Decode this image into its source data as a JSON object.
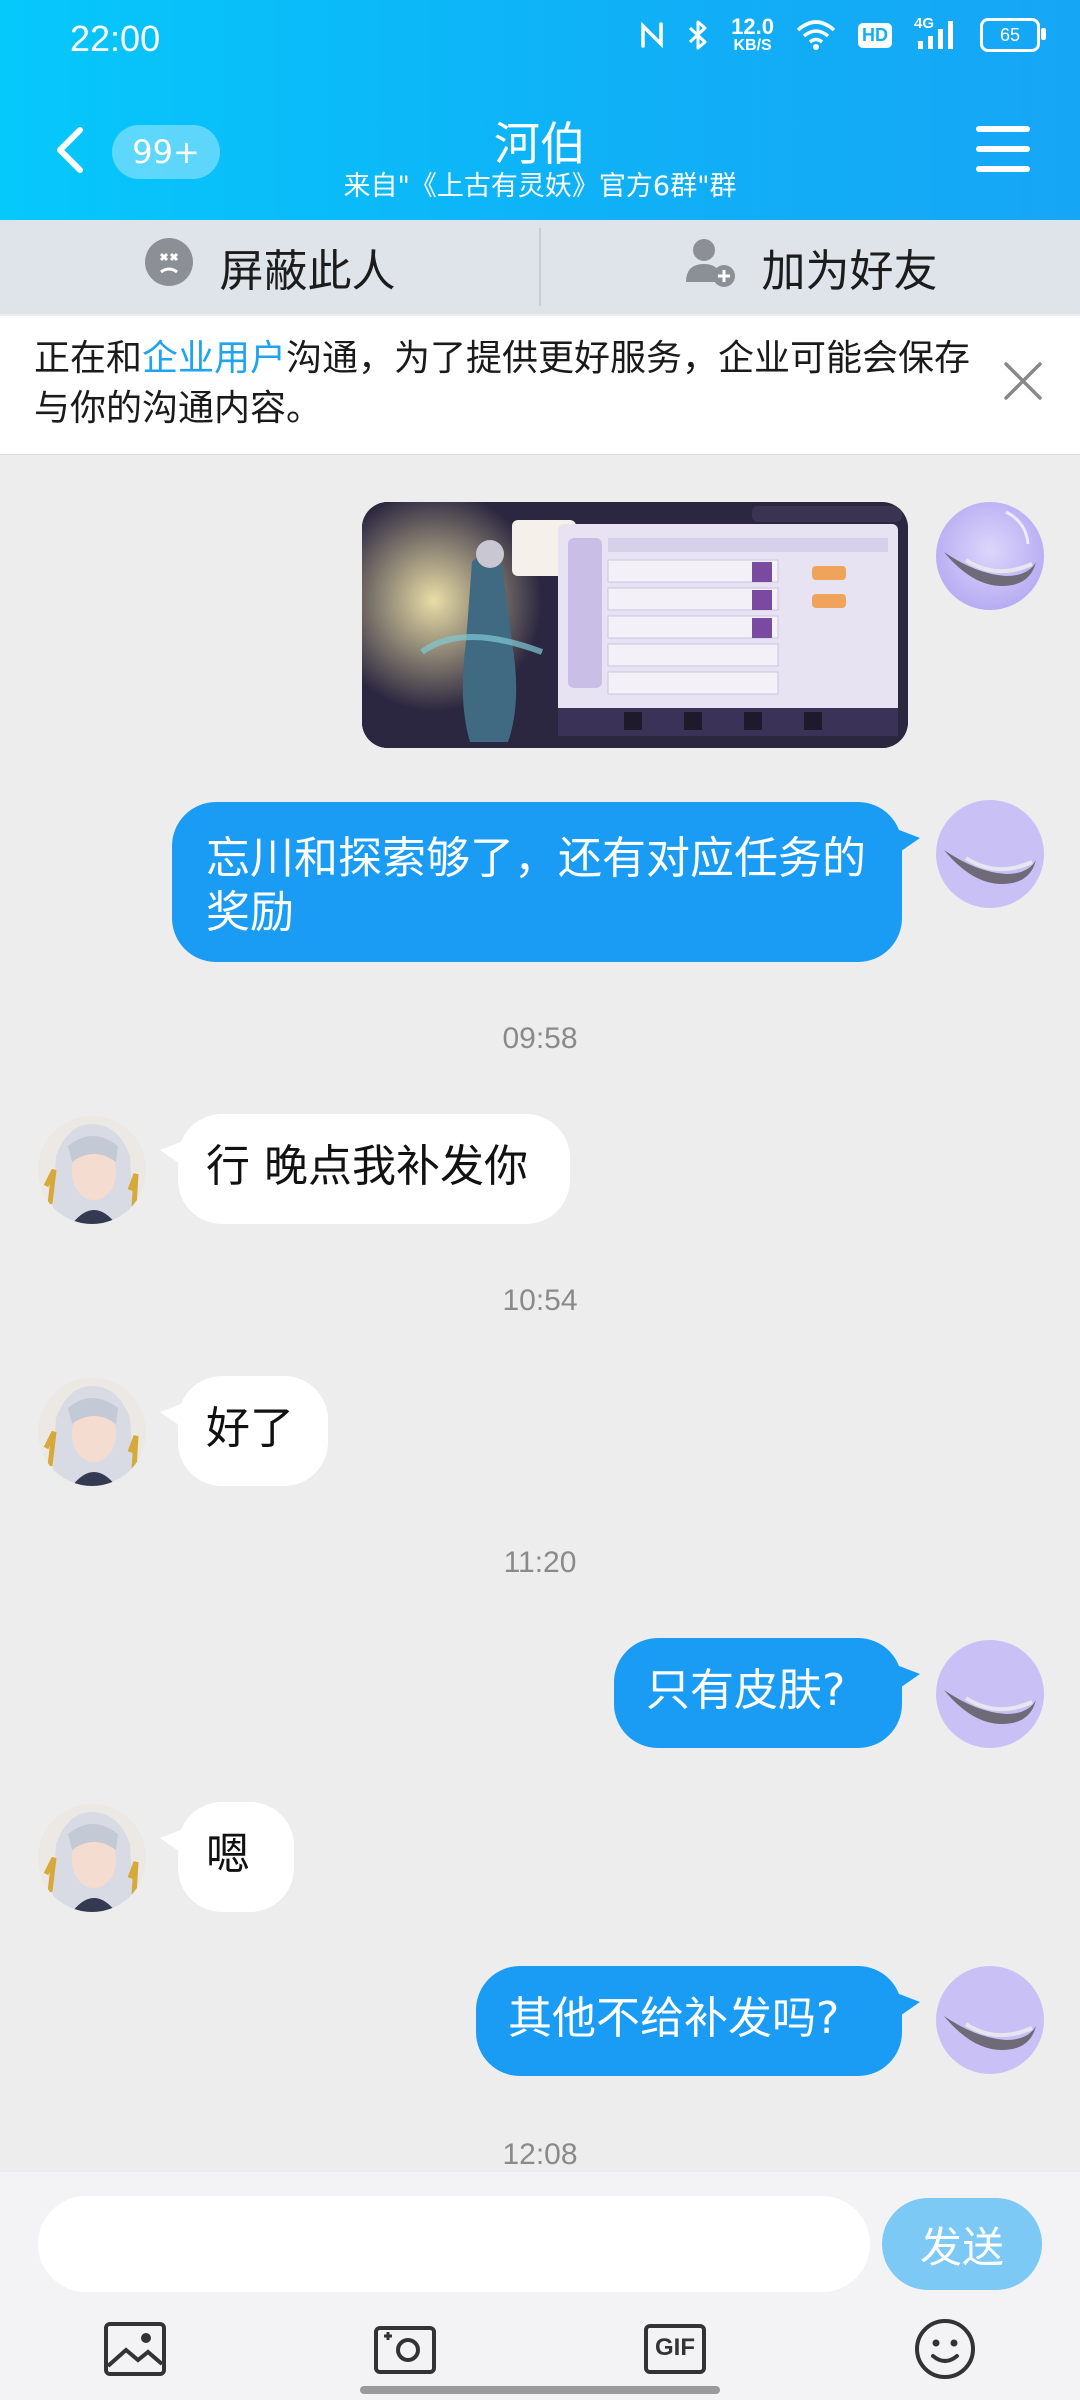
{
  "status_bar": {
    "time": "22:00",
    "speed_value": "12.0",
    "speed_unit": "KB/S",
    "hd": "HD",
    "network": "4G",
    "battery": "65",
    "icons": [
      "nfc-icon",
      "bluetooth-icon",
      "wifi-icon",
      "hd-icon",
      "signal-4g-icon",
      "battery-icon"
    ]
  },
  "header": {
    "unread_badge": "99+",
    "title": "河伯",
    "subtitle": "来自\"《上古有灵妖》官方6群\"群"
  },
  "actions": {
    "block_label": "屏蔽此人",
    "add_friend_label": "加为好友"
  },
  "notice": {
    "prefix": "正在和",
    "link": "企业用户",
    "suffix": "沟通，为了提供更好服务，企业可能会保存与你的沟通内容。"
  },
  "messages": [
    {
      "type": "image",
      "from": "me"
    },
    {
      "type": "text",
      "from": "me",
      "text": "忘川和探索够了，还有对应任务的奖励"
    },
    {
      "type": "time",
      "text": "09:58"
    },
    {
      "type": "text",
      "from": "them",
      "text": "行 晚点我补发你"
    },
    {
      "type": "time",
      "text": "10:54"
    },
    {
      "type": "text",
      "from": "them",
      "text": "好了"
    },
    {
      "type": "time",
      "text": "11:20"
    },
    {
      "type": "text",
      "from": "me",
      "text": "只有皮肤?"
    },
    {
      "type": "text",
      "from": "them",
      "text": "嗯"
    },
    {
      "type": "text",
      "from": "me",
      "text": "其他不给补发吗?"
    },
    {
      "type": "time",
      "text": "12:08"
    }
  ],
  "input": {
    "placeholder": "",
    "send_label": "发送"
  },
  "toolbar": {
    "items": [
      "image-icon",
      "camera-icon",
      "gif-icon",
      "emoji-icon"
    ],
    "gif_label": "GIF"
  },
  "colors": {
    "header_start": "#05c8fb",
    "header_end": "#16a6f6",
    "my_bubble": "#1a9cf4",
    "link": "#1ea4f2",
    "send_button": "#7cc9f6"
  }
}
